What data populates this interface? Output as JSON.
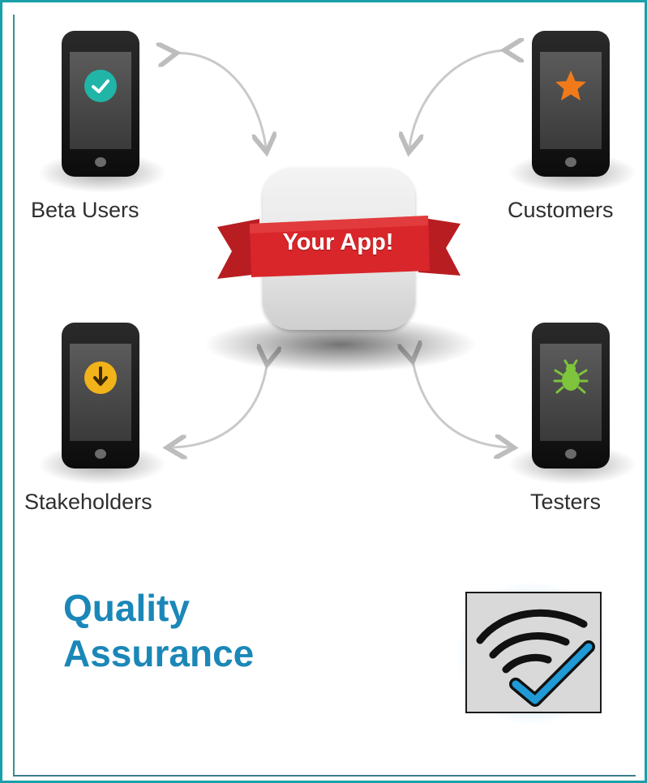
{
  "nodes": {
    "beta_users": "Beta Users",
    "customers": "Customers",
    "stakeholders": "Stakeholders",
    "testers": "Testers"
  },
  "center": {
    "label": "Your App!"
  },
  "footer": {
    "title_line1": "Quality",
    "title_line2": "Assurance"
  },
  "icons": {
    "beta_users": "checkmark-icon",
    "customers": "star-icon",
    "stakeholders": "download-arrow-icon",
    "testers": "bug-icon",
    "logo": "wifi-checkmark-icon"
  },
  "colors": {
    "frame": "#1aa0a8",
    "title": "#1b87b8",
    "ribbon": "#d9262a",
    "check": "#21b5a8",
    "star": "#f07a1a",
    "download": "#f2b31a",
    "bug": "#7ec43c"
  }
}
